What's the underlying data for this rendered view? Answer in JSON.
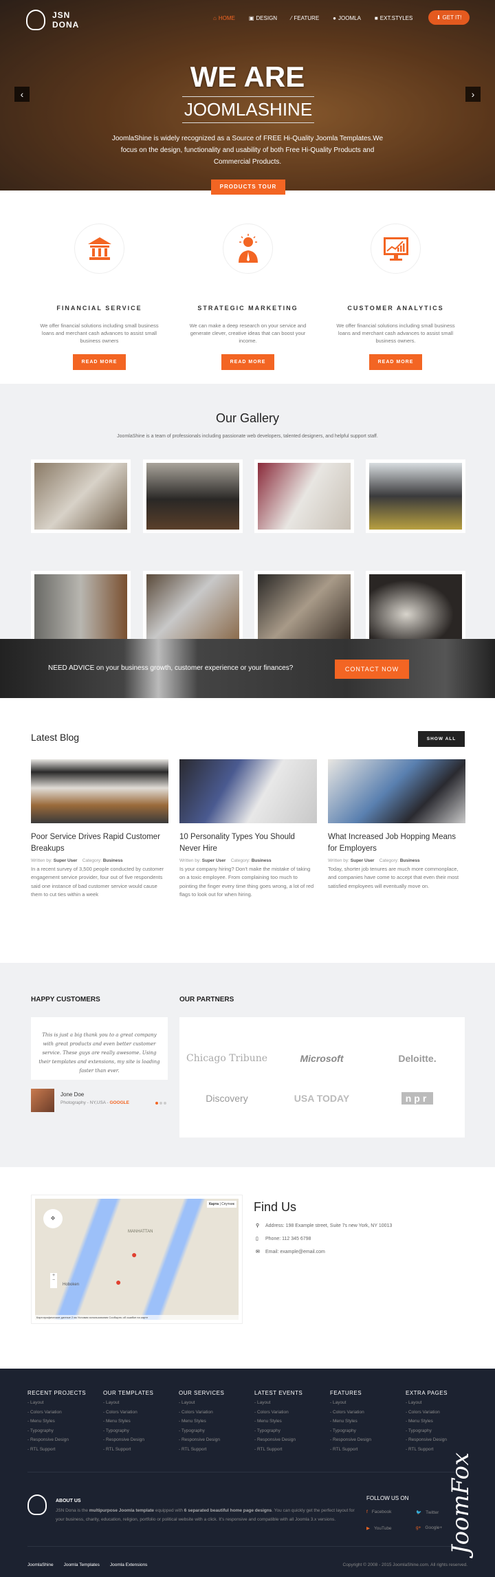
{
  "header": {
    "logo": "JSN DONA",
    "nav": [
      {
        "label": "Home",
        "icon": "home-icon",
        "active": true
      },
      {
        "label": "Design",
        "icon": "image-icon"
      },
      {
        "label": "Feature",
        "icon": "magic-icon"
      },
      {
        "label": "Joomla",
        "icon": "map-marker-icon"
      },
      {
        "label": "Ext.Styles",
        "icon": "gift-icon"
      }
    ],
    "cta": "Get it!"
  },
  "hero": {
    "title": "WE ARE",
    "subtitle": "JOOMLASHINE",
    "text": "JoomlaShine is widely recognized as a Source of FREE Hi-Quality Joomla Templates.We focus on the design, functionality and usability of both Free Hi-Quality Products and Commercial Products.",
    "button": "PRODUCTS TOUR"
  },
  "services": [
    {
      "icon": "bank-icon",
      "title": "FINANCIAL SERVICE",
      "text": "We offer financial solutions including small business loans and merchant cash advances to assist small business owners",
      "button": "READ MORE"
    },
    {
      "icon": "lightbulb-person-icon",
      "title": "STRATEGIC MARKETING",
      "text": "We can make a deep research on your service and generate clever, creative ideas that can boost your income.",
      "button": "READ MORE"
    },
    {
      "icon": "analytics-monitor-icon",
      "title": "CUSTOMER ANALYTICS",
      "text": "We offer financial solutions including small business loans and merchant cash advances to assist small business owners.",
      "button": "READ MORE"
    }
  ],
  "gallery": {
    "title": "Our Gallery",
    "subtitle": "JoomlaShine is a team of professionals including passionate web developers, talented designers, and helpful support staff."
  },
  "cta": {
    "text": "NEED ADVICE on your business growth, customer experience or your finances?",
    "button": "CONTACT NOW"
  },
  "blog": {
    "title": "Latest Blog",
    "show_all": "SHOW ALL",
    "posts": [
      {
        "title": "Poor Service Drives Rapid Customer Breakups",
        "author_label": "Written by:",
        "author": "Super User",
        "category_label": "Category:",
        "category": "Business",
        "text": "In a recent survey of 3,500 people conducted by customer engagement service provider, four out of five respondents said one instance of bad customer service would cause them to cut ties within a week"
      },
      {
        "title": "10 Personality Types You Should Never Hire",
        "author_label": "Written by:",
        "author": "Super User",
        "category_label": "Category:",
        "category": "Business",
        "text": "Is your company hiring? Don't make the mistake of taking on a toxic employee. From complaining too much to pointing the finger every time thing goes wrong, a lot of red flags to look out for when hiring."
      },
      {
        "title": "What Increased Job Hopping Means for Employers",
        "author_label": "Written by:",
        "author": "Super User",
        "category_label": "Category:",
        "category": "Business",
        "text": "Today, shorter job tenures are much more commonplace, and companies have come to accept that even their most satisfied employees will eventually move on."
      }
    ]
  },
  "customers": {
    "title": "HAPPY CUSTOMERS",
    "quote": "This is just a big thank you to a great company with great products and even better customer service. These guys are really awesome. Using their templates and extensions, my site is loading faster than ever.",
    "name": "Jone Doe",
    "role": "Photography - NY,USA -",
    "company": "GOOGLE"
  },
  "partners": {
    "title": "OUR PARTNERS",
    "logos": [
      "Chicago Tribune",
      "Microsoft",
      "Deloitte.",
      "Discovery",
      "USA TODAY",
      "npr"
    ]
  },
  "findus": {
    "title": "Find Us",
    "address": "Address: 198 Example street, Suite 7s new York, NY 10013",
    "phone": "Phone: 112 345 6798",
    "email": "Email: example@email.com",
    "map_labels": {
      "map": "Карта",
      "satellite": "Спутник",
      "manhattan": "MANHATTAN",
      "hoboken": "Hoboken",
      "footer": "Картографические данные   2 км   Условия использования   Сообщить об ошибке на карте"
    }
  },
  "footer": {
    "columns": [
      {
        "title": "RECENT PROJECTS"
      },
      {
        "title": "OUR TEMPLATES"
      },
      {
        "title": "OUR SERVICES"
      },
      {
        "title": "LATEST EVENTS"
      },
      {
        "title": "FEATURES"
      },
      {
        "title": "EXTRA PAGES"
      }
    ],
    "items": [
      "- Layout",
      "- Colors Variation",
      "- Menu Styles",
      "- Typography",
      "- Responsive Design",
      "- RTL Support"
    ],
    "about_title": "ABOUT US",
    "about_pre": "JSN Dona is the ",
    "about_b1": "multipurpose Joomla template",
    "about_mid": " equipped with ",
    "about_b2": "6 separated beautiful home page designs",
    "about_post": ". You can quickly get the perfect layout for your business, charity, education, religion, portfolio or political website with a click. It's responsive and compatible with all Joomla 3.x versions.",
    "follow": "FOLLOW US ON",
    "social": [
      {
        "label": "Facebook",
        "icon": "facebook-icon"
      },
      {
        "label": "Twitter",
        "icon": "twitter-icon"
      },
      {
        "label": "YouTube",
        "icon": "youtube-icon"
      },
      {
        "label": "Google+",
        "icon": "google-plus-icon"
      }
    ],
    "links": [
      "JoomlaShine",
      "Joomla Templates",
      "Joomla Extensions"
    ],
    "copyright": "Copyright © 2008 - 2015 JoomlaShine.com. All rights reserved.",
    "watermark": "JoomFox CREATIVE WEB STUDIO"
  },
  "colors": {
    "accent": "#f36523",
    "footer_bg": "#1c2230",
    "section_bg": "#f0f1f3"
  }
}
